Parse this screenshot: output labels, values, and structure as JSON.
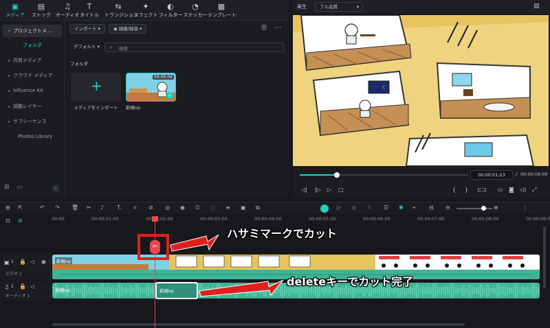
{
  "toolbar": {
    "tabs": [
      {
        "label": "メディア",
        "icon": "media-icon",
        "active": true
      },
      {
        "label": "ストック",
        "icon": "stock-icon"
      },
      {
        "label": "オーディオ",
        "icon": "music-note-icon"
      },
      {
        "label": "タイトル",
        "icon": "title-t-icon"
      },
      {
        "label": "トランジション",
        "icon": "transition-icon"
      },
      {
        "label": "エフェクト",
        "icon": "sparkle-icon"
      },
      {
        "label": "フィルター",
        "icon": "filter-icon"
      },
      {
        "label": "ステッカー",
        "icon": "sticker-icon"
      },
      {
        "label": "テンプレート",
        "icon": "template-icon"
      }
    ]
  },
  "sidebar": {
    "items": [
      {
        "label": "プロジェクトメ...",
        "type": "header"
      },
      {
        "label": "フォルダ",
        "type": "folder"
      },
      {
        "label": "共有メディア",
        "type": "expand"
      },
      {
        "label": "クラウド メディア",
        "type": "expand"
      },
      {
        "label": "Influence Kit",
        "type": "expand"
      },
      {
        "label": "調整レイヤー",
        "type": "expand"
      },
      {
        "label": "サブシーケンス",
        "type": "expand"
      },
      {
        "label": "Photos Library",
        "type": "plain"
      }
    ]
  },
  "media": {
    "import_label": "インポート",
    "record_label": "録画/録音",
    "sort_label": "デフォルト",
    "search_placeholder": "検索",
    "folder_heading": "フォルダ",
    "import_card_label": "メディアをインポート",
    "clip_name": "新規op",
    "clip_duration": "00:00:09"
  },
  "preview": {
    "tab_label": "再生",
    "quality": "フル品質",
    "current_time": "00:00:01:23",
    "separator": "/",
    "total_time": "00:00:09:00",
    "progress": 0.22
  },
  "timeline": {
    "ruler": [
      "00:00",
      "00:00:01:00",
      "00:00:02:00",
      "00:00:03:00",
      "00:00:04:00",
      "00:00:05:00",
      "00:00:06:00",
      "00:00:07:00",
      "00:00:08:00",
      "00:00:09:00"
    ],
    "video_track_label": "ビデオ 1",
    "video_track_num": "1",
    "audio_track_label": "オーディオ 1",
    "audio_track_num": "1",
    "video_clip_name": "新規op",
    "audio_clip_name": "新規op",
    "audio_clip_selected_name": "新規op"
  },
  "annotations": {
    "scissors": "ハサミマークでカット",
    "delete": "deleteキーでカット完了"
  },
  "colors": {
    "accent": "#1fd1c1",
    "playhead": "#e5484d",
    "annotation_red": "#e0201d",
    "video_clip": "#5ec4d4",
    "audio_clip": "#3eb596"
  }
}
